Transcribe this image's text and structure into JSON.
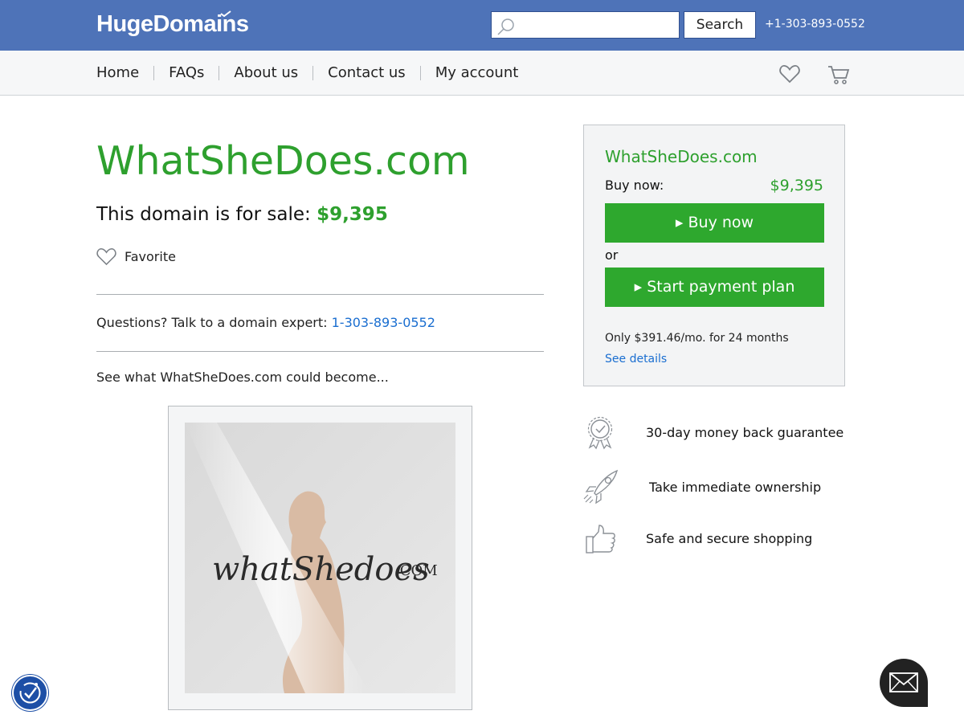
{
  "header": {
    "logo_text": "HugeDomains",
    "search": {
      "placeholder": "",
      "value": "",
      "button_label": "Search"
    },
    "phone": "+1-303-893-0552"
  },
  "nav": {
    "items": [
      {
        "label": "Home"
      },
      {
        "label": "FAQs"
      },
      {
        "label": "About us"
      },
      {
        "label": "Contact us"
      },
      {
        "label": "My account"
      }
    ],
    "icons": [
      "heart-icon",
      "cart-icon"
    ]
  },
  "main": {
    "domain": "WhatSheDoes.com",
    "sale_text": "This domain is for sale: ",
    "price": "$9,395",
    "favorite_label": "Favorite",
    "questions_text": "Questions? Talk to a domain expert: ",
    "questions_phone": "1-303-893-0552",
    "become_text": "See what WhatSheDoes.com could become...",
    "logo_image": {
      "script_text": "whatShedoes",
      "suffix": ".COM"
    }
  },
  "card": {
    "domain": "WhatSheDoes.com",
    "buy_label": "Buy now:",
    "buy_price": "$9,395",
    "buy_button": "▸ Buy now",
    "or_text": "or",
    "plan_button": "▸ Start payment plan",
    "monthly_text": "Only $391.46/mo. for 24 months",
    "details_link": "See details"
  },
  "features": [
    {
      "icon": "award-ribbon-icon",
      "label": "30-day money back guarantee"
    },
    {
      "icon": "rocket-icon",
      "label": "Take immediate ownership"
    },
    {
      "icon": "thumbs-up-icon",
      "label": "Safe and secure shopping"
    }
  ],
  "colors": {
    "header_bg": "#4e73b8",
    "brand_green": "#2ea02e",
    "button_green": "#2ea82e",
    "link_blue": "#1a6ed0",
    "accessibility_blue": "#1d4fa6"
  }
}
